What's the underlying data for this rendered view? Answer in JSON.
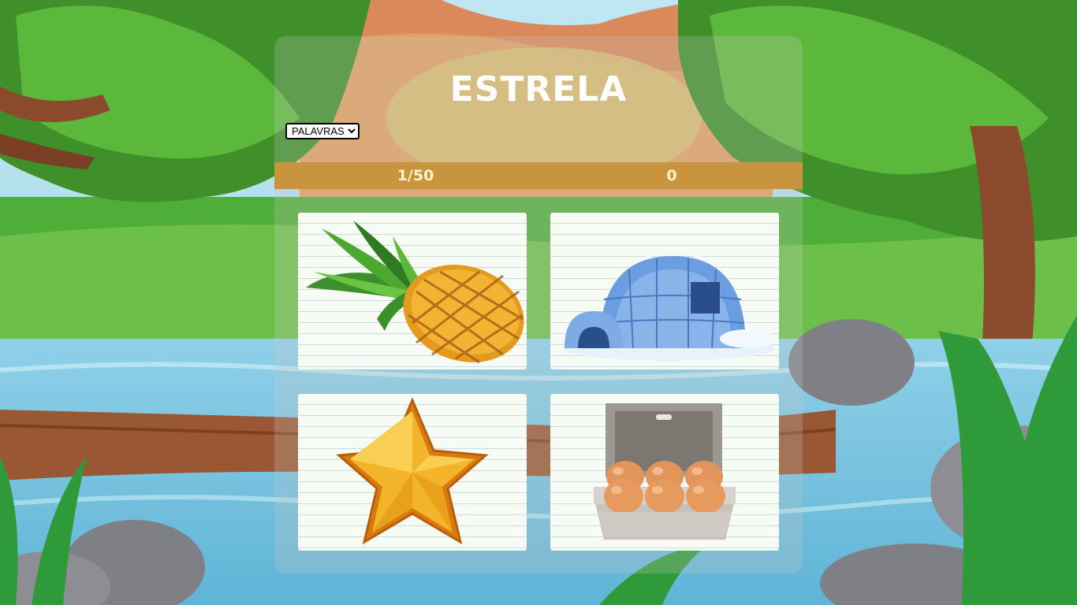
{
  "game": {
    "word": "ESTRELA",
    "mode_select": {
      "selected": "PALAVRAS",
      "options": [
        "PALAVRAS"
      ]
    },
    "progress": "1/50",
    "score": "0"
  },
  "cards": [
    {
      "icon": "pineapple-icon"
    },
    {
      "icon": "igloo-icon"
    },
    {
      "icon": "star-icon"
    },
    {
      "icon": "egg-carton-icon"
    }
  ],
  "colors": {
    "status_bar": "#c8953e",
    "status_text": "#fff4c8",
    "card_bg": "#f6fbf4"
  }
}
